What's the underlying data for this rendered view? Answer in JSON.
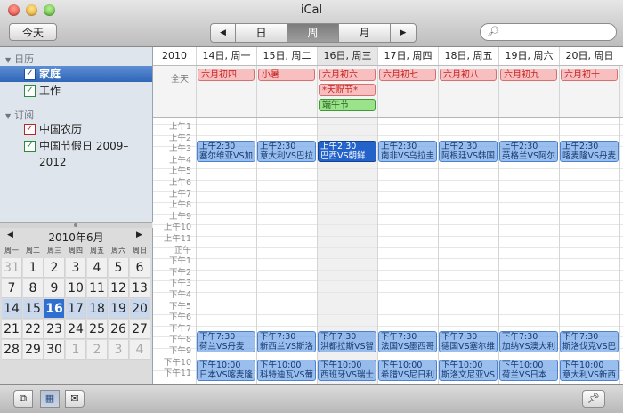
{
  "window": {
    "title": "iCal"
  },
  "toolbar": {
    "today_label": "今天",
    "prev_icon": "◀",
    "next_icon": "▶",
    "views": [
      "日",
      "周",
      "月"
    ],
    "selected_view": "周",
    "search_placeholder": ""
  },
  "sidebar": {
    "calendars_header": "日历",
    "calendars": [
      {
        "label": "家庭",
        "checked": true,
        "color": "#2f6fd6",
        "selected": true
      },
      {
        "label": "工作",
        "checked": true,
        "color": "#3aa64a",
        "selected": false
      }
    ],
    "subscriptions_header": "订阅",
    "subscriptions": [
      {
        "label": "中国农历",
        "checked": true,
        "color": "#d93a3a"
      },
      {
        "label": "中国节假日 2009–2012",
        "checked": true,
        "color": "#3aa64a"
      }
    ]
  },
  "mini_calendar": {
    "title": "2010年6月",
    "dows": [
      "周一",
      "周二",
      "周三",
      "周四",
      "周五",
      "周六",
      "周日"
    ],
    "rows": [
      [
        "31",
        "1",
        "2",
        "3",
        "4",
        "5",
        "6"
      ],
      [
        "7",
        "8",
        "9",
        "10",
        "11",
        "12",
        "13"
      ],
      [
        "14",
        "15",
        "16",
        "17",
        "18",
        "19",
        "20"
      ],
      [
        "21",
        "22",
        "23",
        "24",
        "25",
        "26",
        "27"
      ],
      [
        "28",
        "29",
        "30",
        "1",
        "2",
        "3",
        "4"
      ]
    ],
    "today": "16"
  },
  "week": {
    "year": "2010",
    "days": [
      "14日, 周一",
      "15日, 周二",
      "16日, 周三",
      "17日, 周四",
      "18日, 周五",
      "19日, 周六",
      "20日, 周日"
    ],
    "selected_day_index": 2,
    "allday_label": "全天",
    "allday_events": [
      {
        "day": 0,
        "row": 0,
        "label": "六月初四",
        "color": "red"
      },
      {
        "day": 1,
        "row": 0,
        "label": "小暑",
        "color": "red"
      },
      {
        "day": 2,
        "row": 0,
        "label": "六月初六",
        "color": "red"
      },
      {
        "day": 2,
        "row": 1,
        "label": "*天贶节*",
        "color": "red"
      },
      {
        "day": 2,
        "row": 2,
        "label": "端午节",
        "color": "grn"
      },
      {
        "day": 3,
        "row": 0,
        "label": "六月初七",
        "color": "red"
      },
      {
        "day": 4,
        "row": 0,
        "label": "六月初八",
        "color": "red"
      },
      {
        "day": 5,
        "row": 0,
        "label": "六月初九",
        "color": "red"
      },
      {
        "day": 6,
        "row": 0,
        "label": "六月初十",
        "color": "red"
      }
    ],
    "hours": [
      "上午1",
      "上午2",
      "上午3",
      "上午4",
      "上午5",
      "上午6",
      "上午7",
      "上午8",
      "上午9",
      "上午10",
      "上午11",
      "正午",
      "下午1",
      "下午2",
      "下午3",
      "下午4",
      "下午5",
      "下午6",
      "下午7",
      "下午8",
      "下午9",
      "下午10",
      "下午11"
    ],
    "events": [
      {
        "day": 0,
        "hour": 2.5,
        "time": "上午2:30",
        "title": "塞尔维亚VS加",
        "active": false
      },
      {
        "day": 1,
        "hour": 2.5,
        "time": "上午2:30",
        "title": "意大利VS巴拉",
        "active": false
      },
      {
        "day": 2,
        "hour": 2.5,
        "time": "上午2:30",
        "title": "巴西VS朝鲜",
        "active": true
      },
      {
        "day": 3,
        "hour": 2.5,
        "time": "上午2:30",
        "title": "南非VS乌拉圭",
        "active": false
      },
      {
        "day": 4,
        "hour": 2.5,
        "time": "上午2:30",
        "title": "阿根廷VS韩国",
        "active": false
      },
      {
        "day": 5,
        "hour": 2.5,
        "time": "上午2:30",
        "title": "英格兰VS阿尔",
        "active": false
      },
      {
        "day": 6,
        "hour": 2.5,
        "time": "上午2:30",
        "title": "喀麦隆VS丹麦",
        "active": false
      },
      {
        "day": 0,
        "hour": 19.5,
        "time": "下午7:30",
        "title": "荷兰VS丹麦",
        "active": false
      },
      {
        "day": 1,
        "hour": 19.5,
        "time": "下午7:30",
        "title": "新西兰VS斯洛",
        "active": false
      },
      {
        "day": 2,
        "hour": 19.5,
        "time": "下午7:30",
        "title": "洪都拉斯VS智",
        "active": false
      },
      {
        "day": 3,
        "hour": 19.5,
        "time": "下午7:30",
        "title": "法国VS墨西哥",
        "active": false
      },
      {
        "day": 4,
        "hour": 19.5,
        "time": "下午7:30",
        "title": "德国VS塞尔维",
        "active": false
      },
      {
        "day": 5,
        "hour": 19.5,
        "time": "下午7:30",
        "title": "加纳VS澳大利",
        "active": false
      },
      {
        "day": 6,
        "hour": 19.5,
        "time": "下午7:30",
        "title": "斯洛伐克VS巴",
        "active": false
      },
      {
        "day": 0,
        "hour": 22.0,
        "time": "下午10:00",
        "title": "日本VS喀麦隆",
        "active": false
      },
      {
        "day": 1,
        "hour": 22.0,
        "time": "下午10:00",
        "title": "科特迪瓦VS葡",
        "active": false
      },
      {
        "day": 2,
        "hour": 22.0,
        "time": "下午10:00",
        "title": "西班牙VS瑞士",
        "active": false
      },
      {
        "day": 3,
        "hour": 22.0,
        "time": "下午10:00",
        "title": "希腊VS尼日利",
        "active": false
      },
      {
        "day": 4,
        "hour": 22.0,
        "time": "下午10:00",
        "title": "斯洛文尼亚VS",
        "active": false
      },
      {
        "day": 5,
        "hour": 22.0,
        "time": "下午10:00",
        "title": "荷兰VS日本",
        "active": false
      },
      {
        "day": 6,
        "hour": 22.0,
        "time": "下午10:00",
        "title": "意大利VS新西",
        "active": false
      }
    ]
  },
  "bottombar": {
    "calendars_icon": "calendars-list-icon",
    "minical_icon": "mini-calendar-icon",
    "mail_icon": "mail-icon",
    "pin_icon": "pushpin-icon"
  }
}
